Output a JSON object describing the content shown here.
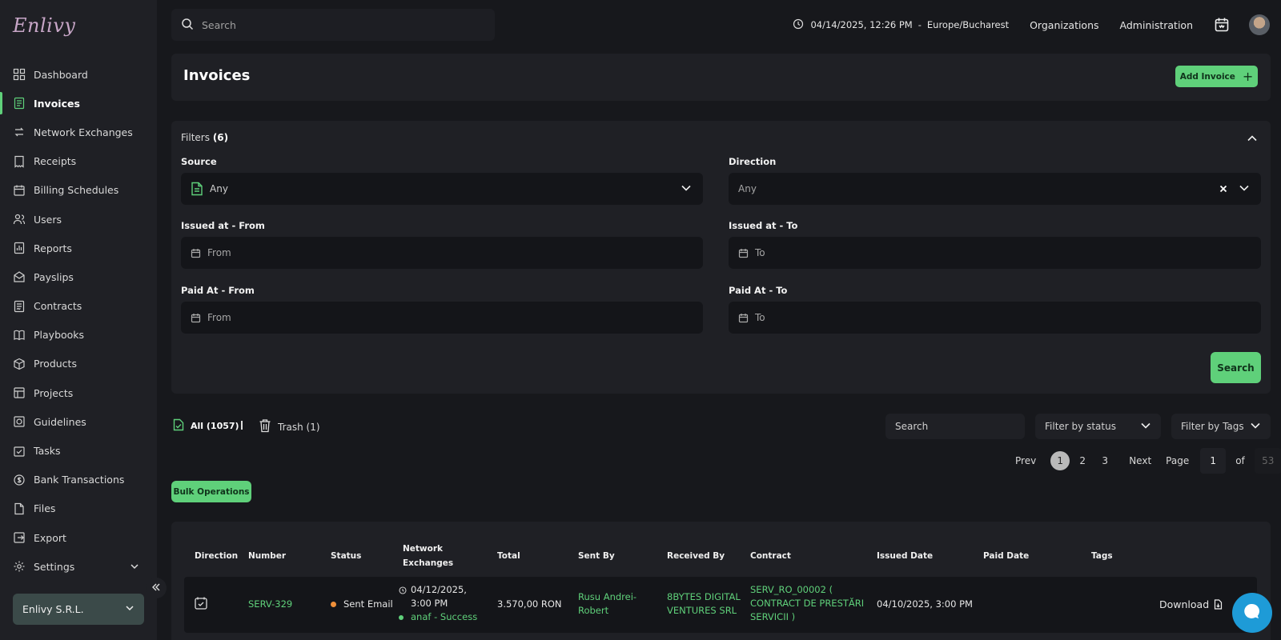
{
  "app": {
    "logo_text": "Enlivy"
  },
  "sidebar": {
    "items": [
      {
        "label": "Dashboard",
        "icon": "dashboard-icon"
      },
      {
        "label": "Invoices",
        "icon": "invoice-icon",
        "active": true
      },
      {
        "label": "Network Exchanges",
        "icon": "network-exchanges-icon"
      },
      {
        "label": "Receipts",
        "icon": "receipt-icon"
      },
      {
        "label": "Billing Schedules",
        "icon": "billing-schedules-icon"
      },
      {
        "label": "Users",
        "icon": "users-icon"
      },
      {
        "label": "Reports",
        "icon": "reports-icon"
      },
      {
        "label": "Payslips",
        "icon": "payslips-icon"
      },
      {
        "label": "Contracts",
        "icon": "contracts-icon"
      },
      {
        "label": "Playbooks",
        "icon": "playbooks-icon"
      },
      {
        "label": "Products",
        "icon": "products-icon"
      },
      {
        "label": "Projects",
        "icon": "projects-icon"
      },
      {
        "label": "Guidelines",
        "icon": "guidelines-icon"
      },
      {
        "label": "Tasks",
        "icon": "tasks-icon"
      },
      {
        "label": "Bank Transactions",
        "icon": "bank-transactions-icon"
      },
      {
        "label": "Files",
        "icon": "files-icon"
      },
      {
        "label": "Export",
        "icon": "export-icon"
      },
      {
        "label": "Settings",
        "icon": "settings-icon"
      }
    ],
    "organization": "Enlivy S.R.L."
  },
  "topbar": {
    "search_placeholder": "Search",
    "datetime": "04/14/2025, 12:26 PM",
    "separator": "-",
    "timezone": "Europe/Bucharest",
    "organizations_label": "Organizations",
    "administration_label": "Administration"
  },
  "page": {
    "title": "Invoices",
    "add_button_label": "Add Invoice"
  },
  "filters": {
    "title": "Filters",
    "count": "(6)",
    "source": {
      "label": "Source",
      "value": "Any"
    },
    "direction": {
      "label": "Direction",
      "value": "Any"
    },
    "issued_from": {
      "label": "Issued at - From",
      "placeholder": "From"
    },
    "issued_to": {
      "label": "Issued at - To",
      "placeholder": "To"
    },
    "paid_from": {
      "label": "Paid At - From",
      "placeholder": "From"
    },
    "paid_to": {
      "label": "Paid At - To",
      "placeholder": "To"
    },
    "search_button": "Search"
  },
  "list": {
    "tab_all": "All (1057)",
    "tab_separator": "|",
    "tab_trash": "Trash (1)",
    "search_placeholder": "Search",
    "filter_status": "Filter by status",
    "filter_tags": "Filter by Tags",
    "bulk_button": "Bulk Operations"
  },
  "pagination": {
    "prev": "Prev",
    "pages": [
      "1",
      "2",
      "3"
    ],
    "current": "1",
    "next": "Next",
    "page_label": "Page",
    "page_input": "1",
    "of_label": "of",
    "total_pages": "53"
  },
  "table": {
    "columns": [
      "Direction",
      "Number",
      "Status",
      "Network Exchanges",
      "Total",
      "Sent By",
      "Received By",
      "Contract",
      "Issued Date",
      "Paid Date",
      "Tags"
    ],
    "rows": [
      {
        "number": "SERV-329",
        "status": "Sent Email",
        "status_color": "#f0903a",
        "network_date": "04/12/2025,",
        "network_time": "3:00 PM",
        "network_status": "anaf - Success",
        "total": "3.570,00 RON",
        "sent_by_line1": "Rusu Andrei-",
        "sent_by_line2": "Robert",
        "received_by_line1": "8BYTES DIGITAL",
        "received_by_line2": "VENTURES SRL",
        "contract_line1": "SERV_RO_00002 (",
        "contract_line2": "CONTRACT DE PRESTĂRI",
        "contract_line3": "SERVICII )",
        "issued_date": "04/10/2025, 3:00 PM",
        "paid_date": "",
        "download_label": "Download"
      }
    ]
  },
  "colors": {
    "accent": "#5fd07a",
    "background": "#17181c",
    "panel": "#1f2025",
    "chat": "#1e9bd7"
  }
}
